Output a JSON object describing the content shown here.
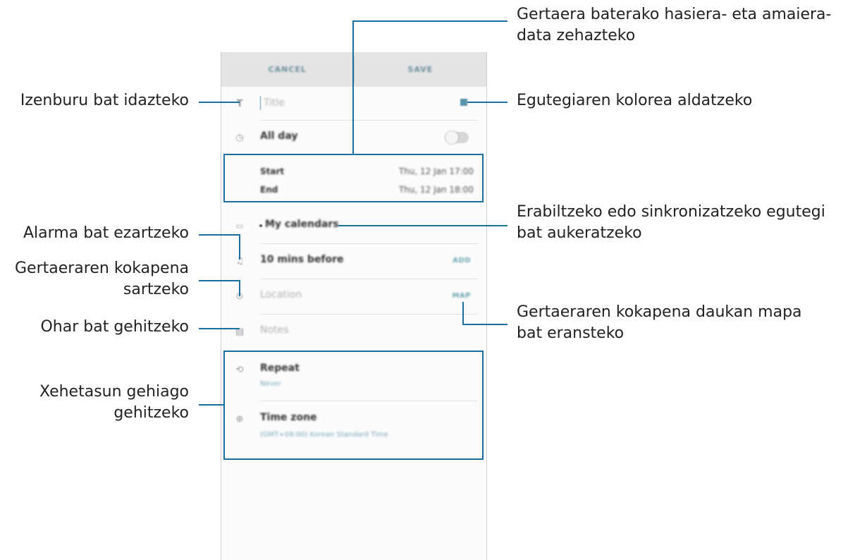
{
  "screen": {
    "cancel_label": "CANCEL",
    "save_label": "SAVE",
    "title_placeholder": "Title",
    "all_day_label": "All day",
    "start_label": "Start",
    "start_value": "Thu, 12 Jan   17:00",
    "end_label": "End",
    "end_value": "Thu, 12 Jan   18:00",
    "calendar_label": "My calendars",
    "alarm_label": "10 mins before",
    "alarm_action": "ADD",
    "location_placeholder": "Location",
    "location_action": "MAP",
    "notes_placeholder": "Notes",
    "repeat_label": "Repeat",
    "repeat_value": "Never",
    "timezone_label": "Time zone",
    "timezone_value": "(GMT+09:00) Korean Standard Time",
    "colors": {
      "accent": "#5a93a8",
      "callout_line": "#1a6fa0"
    }
  },
  "callouts": {
    "title": "Izenburu bat idazteko",
    "date_line1": "Gertaera baterako hasiera- eta amaiera-",
    "date_line2": "data zehazteko",
    "color": "Egutegiaren kolorea aldatzeko",
    "calendar_line1": "Erabiltzeko edo sinkronizatzeko egutegi",
    "calendar_line2": "bat aukeratzeko",
    "alarm": "Alarma bat ezartzeko",
    "location_line1": "Gertaeraren kokapena",
    "location_line2": "sartzeko",
    "notes": "Ohar bat gehitzeko",
    "map_line1": "Gertaeraren kokapena daukan mapa",
    "map_line2": "bat eransteko",
    "details_line1": "Xehetasun gehiago",
    "details_line2": "gehitzeko"
  }
}
